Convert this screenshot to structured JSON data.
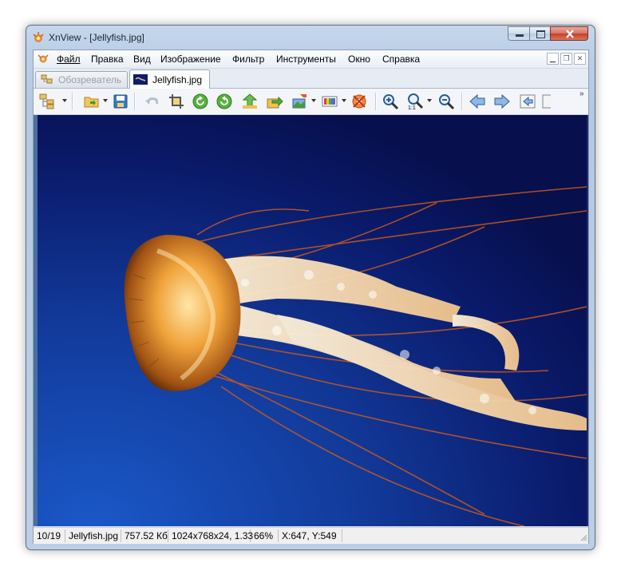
{
  "window": {
    "title": "XnView - [Jellyfish.jpg]"
  },
  "menubar": {
    "items": [
      "Файл",
      "Правка",
      "Вид",
      "Изображение",
      "Фильтр",
      "Инструменты",
      "Окно",
      "Справка"
    ]
  },
  "tabs": [
    {
      "label": "Обозреватель",
      "active": false
    },
    {
      "label": "Jellyfish.jpg",
      "active": true
    }
  ],
  "toolbar": {
    "buttons": [
      "browser-icon",
      "open-folder-icon",
      "save-icon",
      "undo-icon",
      "crop-icon",
      "rotate-left-icon",
      "rotate-right-icon",
      "go-up-icon",
      "export-icon",
      "convert-icon",
      "color-adjust-icon",
      "settings-icon",
      "zoom-in-icon",
      "zoom-actual-icon",
      "zoom-out-icon",
      "previous-icon",
      "next-icon",
      "first-icon",
      "last-icon"
    ]
  },
  "statusbar": {
    "index": "10/19",
    "filename": "Jellyfish.jpg",
    "filesize": "757.52 Кб",
    "dimensions": "1024x768x24, 1.33",
    "zoom": "66%",
    "coords": "X:647, Y:549"
  },
  "colors": {
    "accent": "#3c7fb1",
    "background_deep": "#0b1660"
  }
}
